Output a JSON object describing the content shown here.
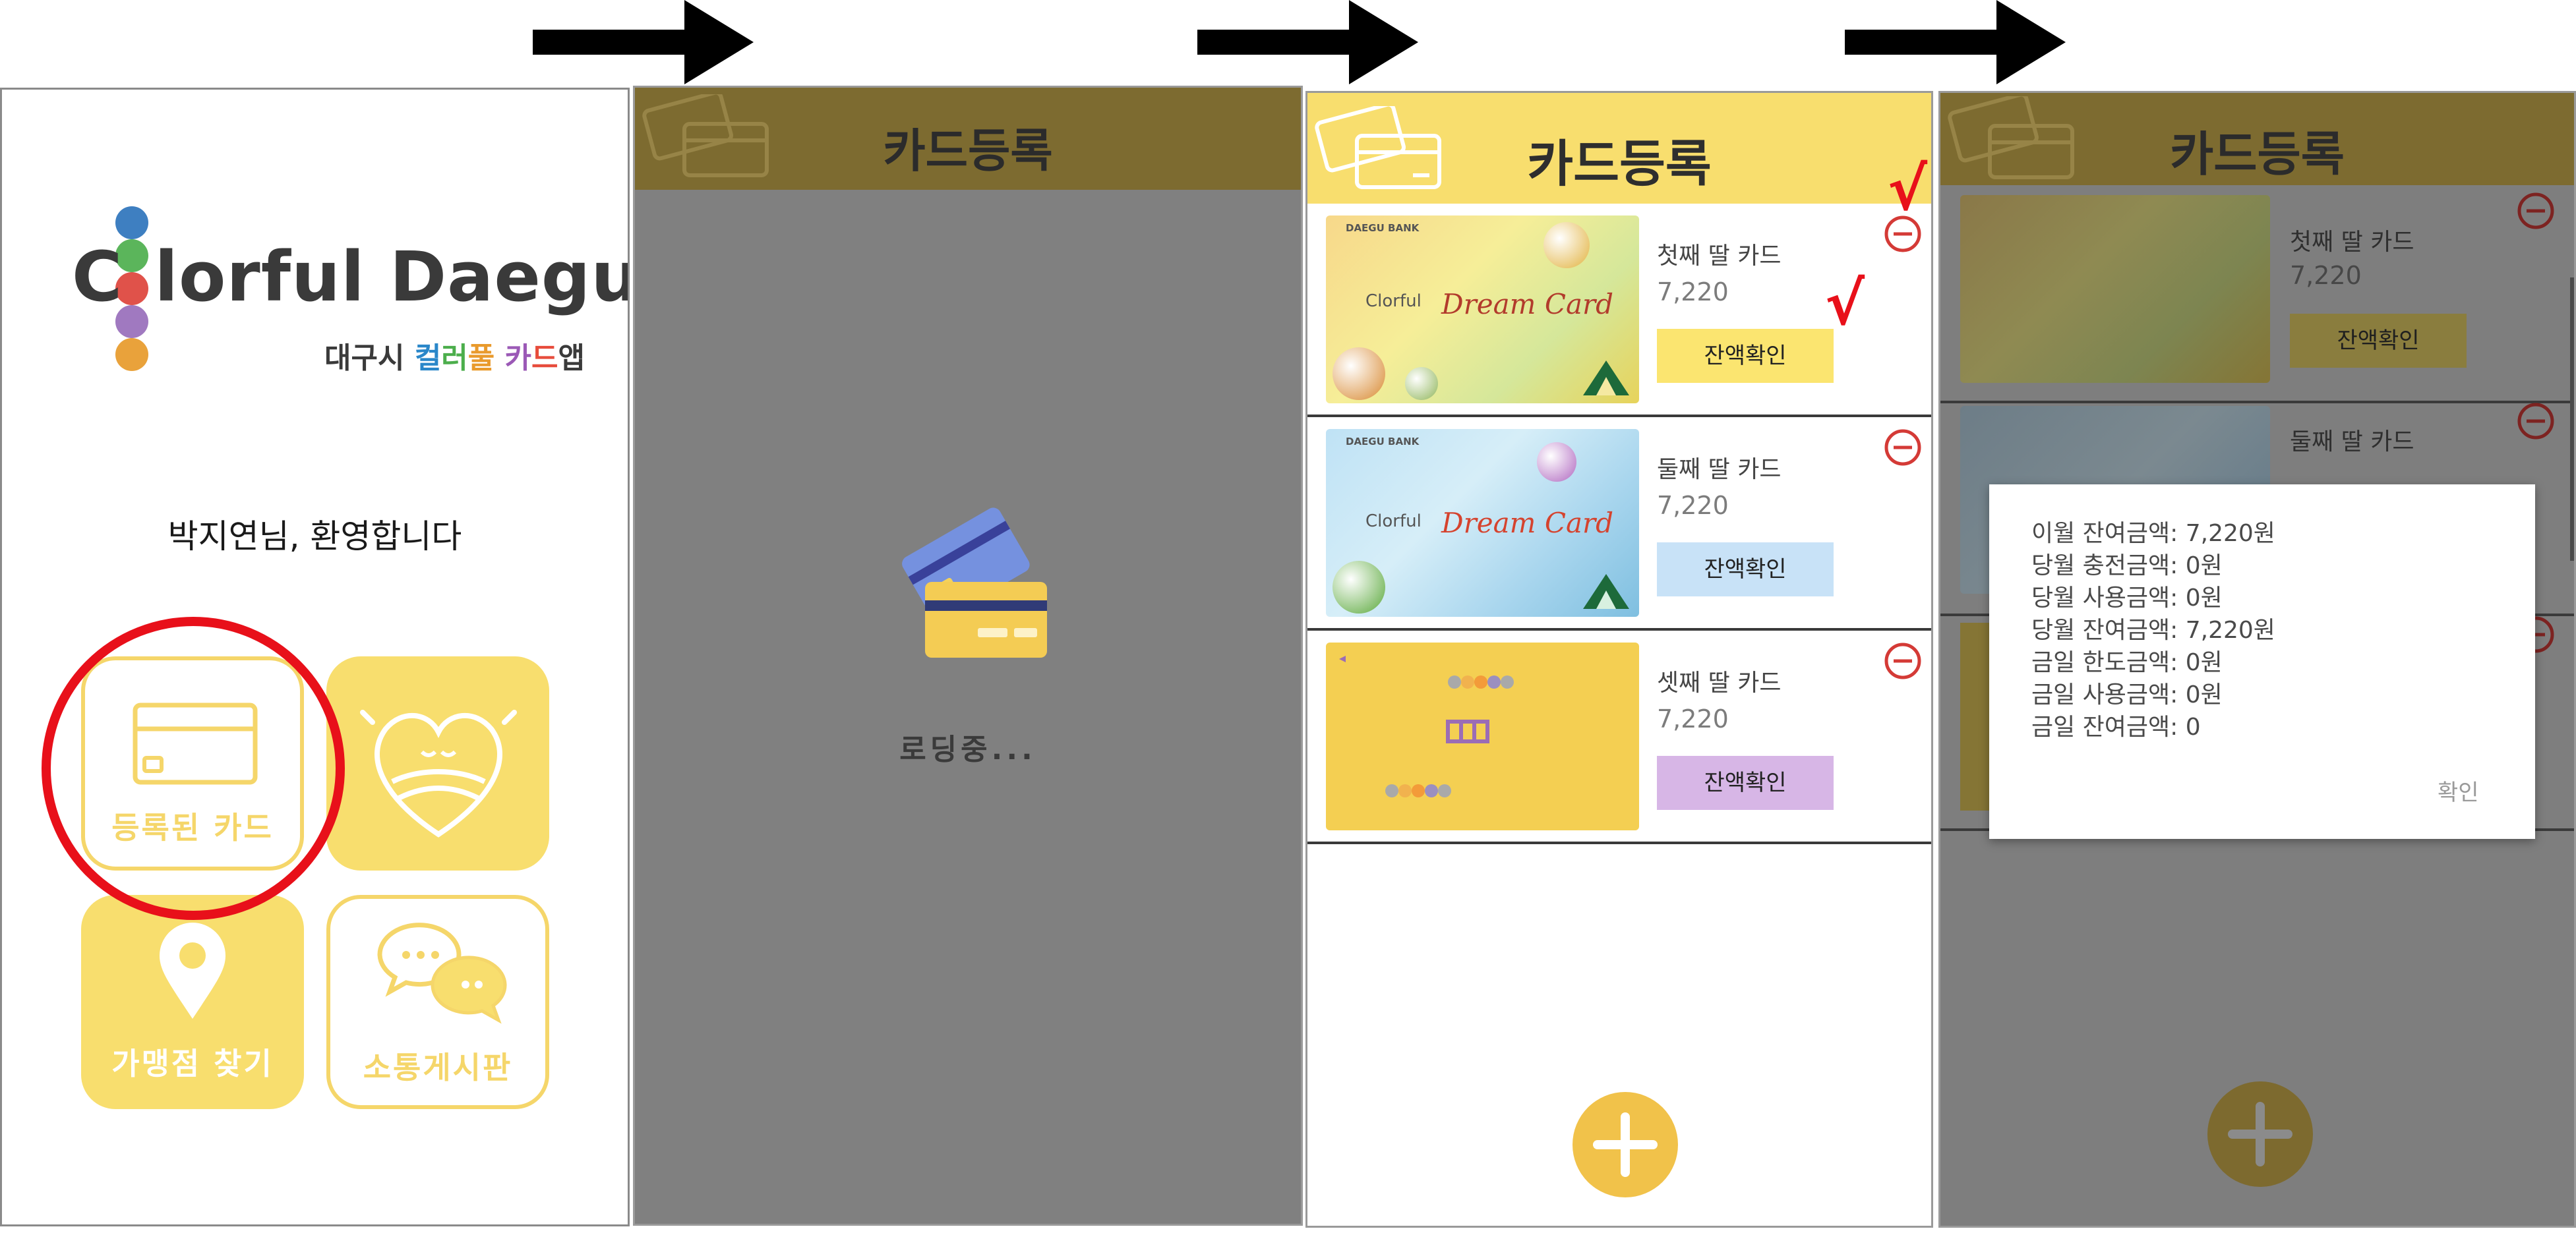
{
  "screen1": {
    "logo_c": "C",
    "logo_rest": "lorful Daegu",
    "subtitle_prefix": "대구시",
    "subtitle_chars": [
      {
        "ch": "컬",
        "color": "#2a87c9"
      },
      {
        "ch": "러",
        "color": "#4cae4c"
      },
      {
        "ch": "풀",
        "color": "#e99a2c"
      },
      {
        "ch": "카",
        "color": "#9b59b6"
      },
      {
        "ch": "드",
        "color": "#e74c3c"
      }
    ],
    "subtitle_suffix": "앱",
    "logo_dot_colors": [
      "#3e7fc1",
      "#5bb55b",
      "#e0524a",
      "#a079c0",
      "#e9a23b"
    ],
    "welcome": "박지연님, 환영합니다",
    "tiles": {
      "registered_card": "등록된 카드",
      "find_store": "가맹점 찾기",
      "community": "소통게시판"
    }
  },
  "screen2": {
    "title": "카드등록",
    "loading": "로딩중..."
  },
  "screen3": {
    "title": "카드등록",
    "cards": [
      {
        "name": "첫째 딸 카드",
        "balance": "7,220",
        "button": "잔액확인",
        "button_color": "#fbe570",
        "image_title": "Dream Card",
        "bank": "DAEGU BANK",
        "brand_c": "C",
        "brand_rest": "lorful"
      },
      {
        "name": "둘째 딸 카드",
        "balance": "7,220",
        "button": "잔액확인",
        "button_color": "#c8e2f7",
        "image_title": "Dream Card",
        "bank": "DAEGU BANK",
        "brand_c": "C",
        "brand_rest": "lorful"
      },
      {
        "name": "셋째 딸 카드",
        "balance": "7,220",
        "button": "잔액확인",
        "button_color": "#d7b6e6"
      }
    ],
    "check_marks": [
      "√",
      "√"
    ]
  },
  "screen4": {
    "title": "카드등록",
    "card1": {
      "name": "첫째 딸 카드",
      "balance": "7,220",
      "button": "잔액확인"
    },
    "card2": {
      "name": "둘째 딸 카드"
    },
    "popup": {
      "lines": [
        "이월 잔여금액: 7,220원",
        "당월 충전금액: 0원",
        "당월 사용금액: 0원",
        "당월 잔여금액: 7,220원",
        "금일 한도금액: 0원",
        "금일 사용금액: 0원",
        "금일 잔여금액: 0"
      ],
      "confirm": "확인"
    }
  },
  "colors": {
    "accent_yellow": "#f8de6e",
    "annotation_red": "#e8101a",
    "overlay_gray": "#808080"
  }
}
